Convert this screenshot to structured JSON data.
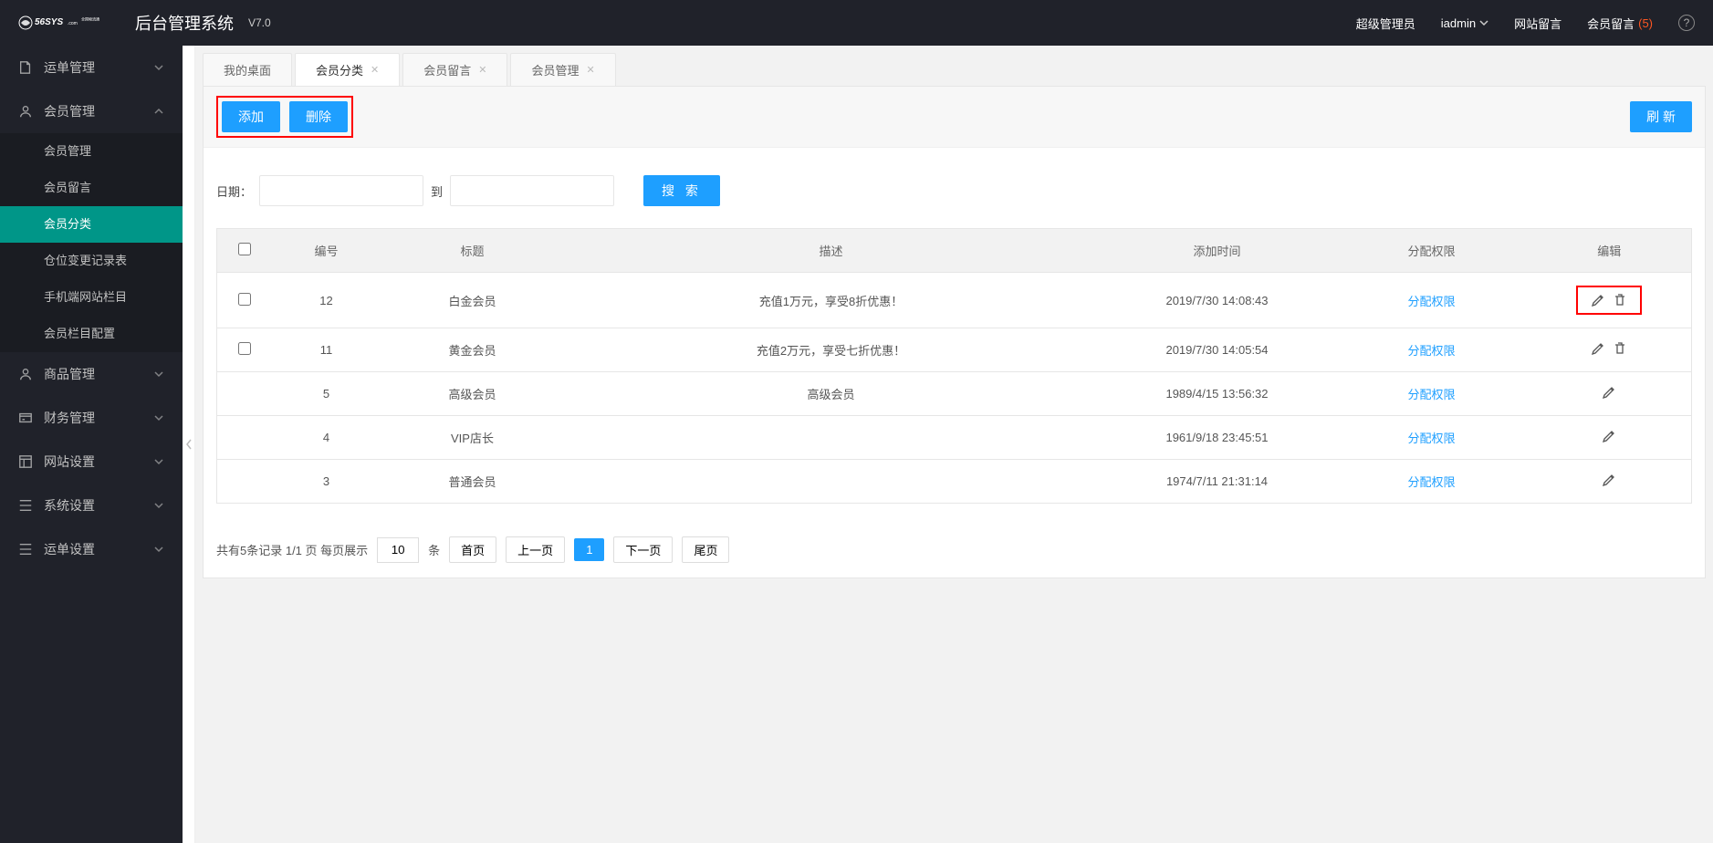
{
  "header": {
    "logo_text": "56SYS.com",
    "logo_sub": "全国物流通",
    "system_title": "后台管理系统",
    "version": "V7.0",
    "role_label": "超级管理员",
    "username": "iadmin",
    "site_msg": "网站留言",
    "member_msg_label": "会员留言",
    "member_msg_count": "(5)"
  },
  "sidebar": {
    "items": [
      {
        "label": "运单管理",
        "icon": "doc"
      },
      {
        "label": "会员管理",
        "icon": "user",
        "expanded": true,
        "children": [
          {
            "label": "会员管理"
          },
          {
            "label": "会员留言"
          },
          {
            "label": "会员分类",
            "active": true
          },
          {
            "label": "仓位变更记录表"
          },
          {
            "label": "手机端网站栏目"
          },
          {
            "label": "会员栏目配置"
          }
        ]
      },
      {
        "label": "商品管理",
        "icon": "user2"
      },
      {
        "label": "财务管理",
        "icon": "money"
      },
      {
        "label": "网站设置",
        "icon": "layout"
      },
      {
        "label": "系统设置",
        "icon": "gear"
      },
      {
        "label": "运单设置",
        "icon": "list"
      }
    ]
  },
  "tabs": [
    {
      "label": "我的桌面",
      "closable": false
    },
    {
      "label": "会员分类",
      "closable": true,
      "active": true
    },
    {
      "label": "会员留言",
      "closable": true
    },
    {
      "label": "会员管理",
      "closable": true
    }
  ],
  "toolbar": {
    "add": "添加",
    "delete": "删除",
    "refresh": "刷 新"
  },
  "search": {
    "date_label": "日期：",
    "to_label": "到",
    "search_btn": "搜 索"
  },
  "table": {
    "headers": {
      "id": "编号",
      "title": "标题",
      "desc": "描述",
      "time": "添加时间",
      "perm": "分配权限",
      "edit": "编辑"
    },
    "perm_link": "分配权限",
    "rows": [
      {
        "id": "12",
        "title": "白金会员",
        "desc": "充值1万元，享受8折优惠！",
        "time": "2019/7/30 14:08:43",
        "checkbox": true,
        "deletable": true,
        "highlight": true
      },
      {
        "id": "11",
        "title": "黄金会员",
        "desc": "充值2万元，享受七折优惠！",
        "time": "2019/7/30 14:05:54",
        "checkbox": true,
        "deletable": true
      },
      {
        "id": "5",
        "title": "高级会员",
        "desc": "高级会员",
        "time": "1989/4/15 13:56:32",
        "checkbox": false,
        "deletable": false
      },
      {
        "id": "4",
        "title": "VIP店长",
        "desc": "",
        "time": "1961/9/18 23:45:51",
        "checkbox": false,
        "deletable": false
      },
      {
        "id": "3",
        "title": "普通会员",
        "desc": "",
        "time": "1974/7/11 21:31:14",
        "checkbox": false,
        "deletable": false
      }
    ]
  },
  "pagination": {
    "summary": "共有5条记录  1/1 页  每页展示",
    "per_page": "10",
    "unit": "条",
    "first": "首页",
    "prev": "上一页",
    "page1": "1",
    "next": "下一页",
    "last": "尾页"
  }
}
